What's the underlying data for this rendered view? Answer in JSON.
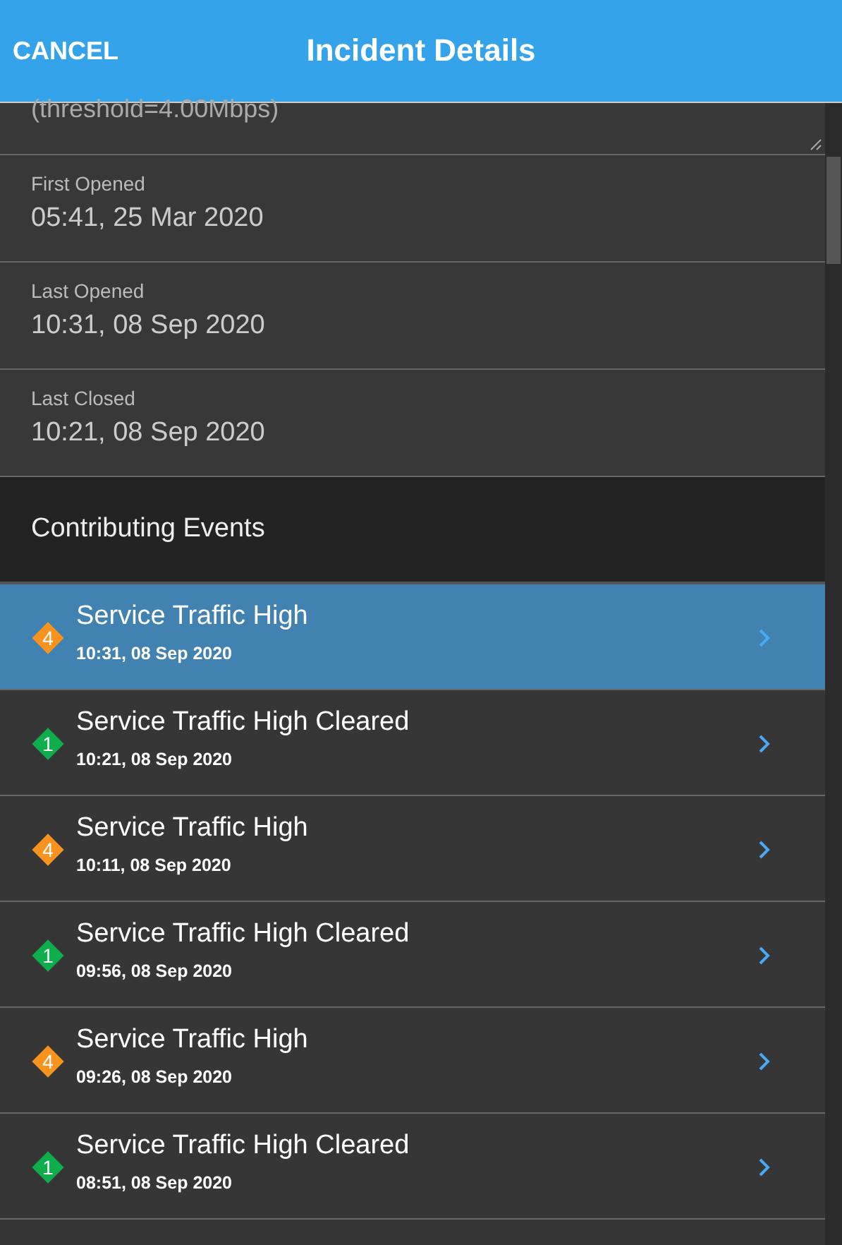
{
  "header": {
    "cancel": "CANCEL",
    "title": "Incident Details"
  },
  "description": "(threshold=4.00Mbps)",
  "fields": [
    {
      "label": "First Opened",
      "value": "05:41, 25 Mar 2020"
    },
    {
      "label": "Last Opened",
      "value": "10:31, 08 Sep 2020"
    },
    {
      "label": "Last Closed",
      "value": "10:21, 08 Sep 2020"
    }
  ],
  "section_title": "Contributing Events",
  "events": [
    {
      "severity": "4",
      "color": "#f7931e",
      "title": "Service Traffic High",
      "time": "10:31, 08 Sep 2020",
      "selected": true
    },
    {
      "severity": "1",
      "color": "#0fae4c",
      "title": "Service Traffic High Cleared",
      "time": "10:21, 08 Sep 2020",
      "selected": false
    },
    {
      "severity": "4",
      "color": "#f7931e",
      "title": "Service Traffic High",
      "time": "10:11, 08 Sep 2020",
      "selected": false
    },
    {
      "severity": "1",
      "color": "#0fae4c",
      "title": "Service Traffic High Cleared",
      "time": "09:56, 08 Sep 2020",
      "selected": false
    },
    {
      "severity": "4",
      "color": "#f7931e",
      "title": "Service Traffic High",
      "time": "09:26, 08 Sep 2020",
      "selected": false
    },
    {
      "severity": "1",
      "color": "#0fae4c",
      "title": "Service Traffic High Cleared",
      "time": "08:51, 08 Sep 2020",
      "selected": false
    }
  ]
}
